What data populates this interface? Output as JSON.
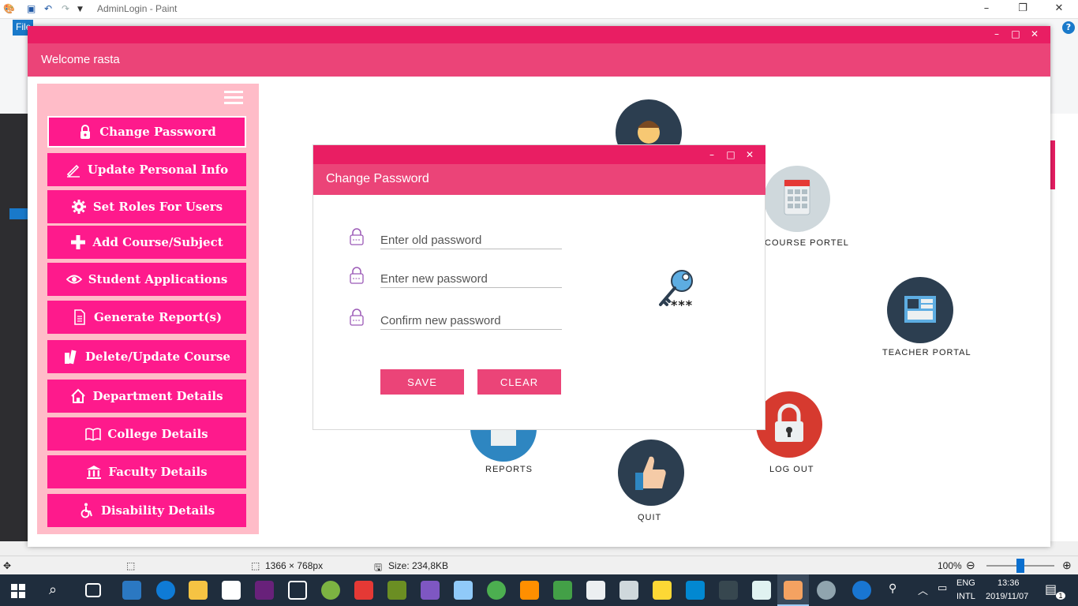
{
  "paint": {
    "title": "AdminLogin - Paint",
    "file_tab": "File",
    "status": {
      "dimensions": "1366 × 768px",
      "size": "Size: 234,8KB",
      "zoom": "100%"
    }
  },
  "app": {
    "welcome": "Welcome rasta",
    "menu": [
      {
        "label": "Change Password",
        "icon": "lock-icon"
      },
      {
        "label": "Update Personal Info",
        "icon": "pen-icon"
      },
      {
        "label": "Set Roles For Users",
        "icon": "gear-icon"
      },
      {
        "label": "Add Course/Subject",
        "icon": "plus-icon"
      },
      {
        "label": "Student Applications",
        "icon": "eye-icon"
      },
      {
        "label": "Generate Report(s)",
        "icon": "document-icon"
      },
      {
        "label": "Delete/Update Course",
        "icon": "books-icon"
      },
      {
        "label": "Department Details",
        "icon": "home-icon"
      },
      {
        "label": "College Details",
        "icon": "open-book-icon"
      },
      {
        "label": "Faculty Details",
        "icon": "bank-icon"
      },
      {
        "label": "Disability Details",
        "icon": "wheelchair-icon"
      }
    ],
    "dashboard": {
      "course_portal": "COURSE PORTEL",
      "teacher_portal": "TEACHER PORTAL",
      "reports": "REPORTS",
      "quit": "QUIT",
      "log_out": "LOG OUT"
    }
  },
  "dialog": {
    "title": "Change Password",
    "old_password_placeholder": "Enter old password",
    "new_password_placeholder": "Enter new password",
    "confirm_password_placeholder": "Confirm new password",
    "key_stars": "***",
    "save_label": "SAVE",
    "clear_label": "CLEAR"
  },
  "taskbar": {
    "language": "ENG",
    "layout": "INTL",
    "time": "13:36",
    "date": "2019/11/07",
    "notification_count": "1"
  },
  "colors": {
    "primary_pink": "#e91e63",
    "header_pink": "#eb4478",
    "menu_pink": "#fe1a8c",
    "panel_pink": "#ffbcc8"
  }
}
